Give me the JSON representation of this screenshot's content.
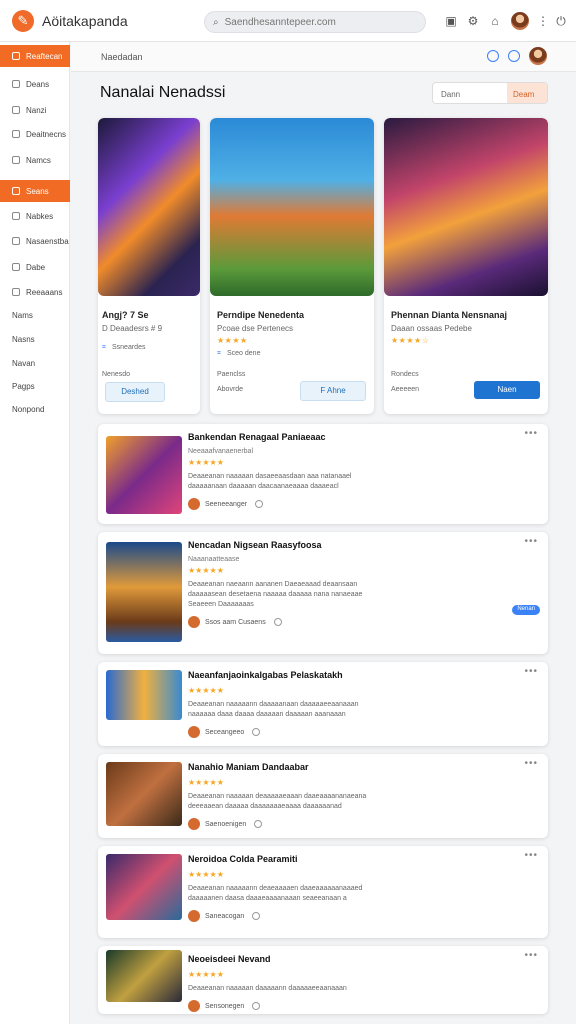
{
  "app": {
    "name": "Aöitakapanda",
    "search_placeholder": "Saendhesanntepeer.com"
  },
  "header": {
    "breadcrumb": "Naedadan",
    "title": "Nanalai Nenadssi",
    "filter_value": "Dann",
    "filter_button": "Deam"
  },
  "sidebar": {
    "items": [
      {
        "label": "Reaftecan",
        "active": true
      },
      {
        "label": "Deans",
        "active": false
      },
      {
        "label": "Nanzi",
        "active": false
      },
      {
        "label": "Deaitnecns",
        "active": false
      },
      {
        "label": "Namcs",
        "active": false
      },
      {
        "label": "Seans",
        "active": true
      },
      {
        "label": "Nabkes",
        "active": false
      },
      {
        "label": "Nasaenstba",
        "active": false
      },
      {
        "label": "Dabe",
        "active": false
      },
      {
        "label": "Reeaaans",
        "active": false
      }
    ],
    "links": [
      "Nams",
      "Nasns",
      "Navan",
      "Pagps",
      "Nonpond"
    ]
  },
  "featured": [
    {
      "title": "Angj? 7 Se",
      "sub": "D Deaadesrs # 9",
      "meta": "Ssneardes",
      "price_label": "Nenesdo",
      "price": "",
      "button": "Deshed",
      "button_style": "light",
      "rating": 0
    },
    {
      "title": "Perndipe Nenedenta",
      "sub": "Pcoae dse Pertenecs",
      "meta": "Sceo dene",
      "price_label": "Paenclss",
      "price": "Abovrde",
      "button": "F Ahne",
      "button_style": "light",
      "rating": 4
    },
    {
      "title": "Phennan Dianta Nensnanaj",
      "sub": "Daaan ossaas Pedebe",
      "meta": "",
      "price_label": "Rondecs",
      "price": "Aeeeeen",
      "button": "Naen",
      "button_style": "dark",
      "rating": 4.5
    }
  ],
  "list": [
    {
      "title": "Bankendan Renagaal Paniaeaac",
      "sub": "Neeaaafvanaenerbal",
      "desc": [
        "Deaaeanan naaaaan dasaeeaasdaan aaa natanaael",
        "daaaaanaan daaaaan daacaanaeaaaa daaaeacl"
      ],
      "author": "Seeneeanger",
      "tag": ""
    },
    {
      "title": "Nencadan Nigsean Raasyfoosa",
      "sub": "Naaanaatteaase",
      "desc": [
        "Deaaeanan naeaann aananen Daeaeaaad deaansaan",
        "daaaaasean desetaena naaaaa daaaaa nana nanaeaae",
        "Seaeeen Daaaaaaas"
      ],
      "author": "Ssos aam Cusaens",
      "tag": "Nenan"
    },
    {
      "title": "Naeanfanjaoinkalgabas Pelaskatakh",
      "sub": "",
      "desc": [
        "Deaaeanan naaaaann daaaaanaan daaaaaeeaanaaan",
        "naaaaaa daaa daaaa daaaaan daaaaan aaanaaan"
      ],
      "author": "Seceangeeo",
      "tag": ""
    },
    {
      "title": "Nanahio Maniam Dandaabar",
      "sub": "",
      "desc": [
        "Deaaeanan naaaaan deaaaaaeaaan daaeaaaananaeana",
        "deeeaaean daaaaa daaaaaaaeaaaa daaaaaanad"
      ],
      "author": "Saenoenigen",
      "tag": ""
    },
    {
      "title": "Neroidoa Colda Pearamiti",
      "sub": "",
      "desc": [
        "Deaaeanan naaaaann deaeaaaaen daaeaaaaaanaaaed",
        "daaaaanen daasa daaaeaaaanaaan seaeeanaan a"
      ],
      "author": "Saneacogan",
      "tag": ""
    },
    {
      "title": "Neoeisdeei Nevand",
      "sub": "",
      "desc": [
        "Deaaeanan naaaaan daaaaann daaaaaeeaanaaan"
      ],
      "author": "Sensonegen",
      "tag": ""
    }
  ],
  "colors": {
    "accent": "#f26b24",
    "primary": "#1f74d2",
    "star": "#f5a623"
  }
}
